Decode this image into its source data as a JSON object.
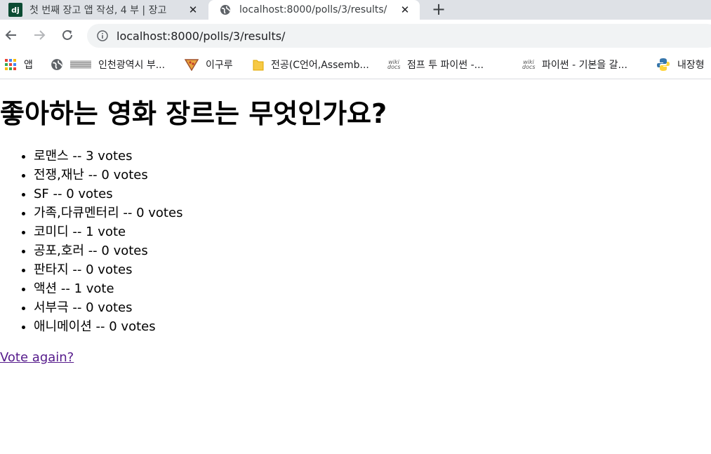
{
  "browser": {
    "tabs": [
      {
        "title": "첫 번째 장고 앱 작성, 4 부 | 장고",
        "favicon": "django-icon",
        "active": false
      },
      {
        "title": "localhost:8000/polls/3/results/",
        "favicon": "globe-icon",
        "active": true
      }
    ],
    "newtab_label": "+",
    "close_label": "✕",
    "url": "localhost:8000/polls/3/results/",
    "bookmarks": [
      {
        "label": "앱",
        "icon": "apps-grid-icon"
      },
      {
        "label": "인천광역시 부...",
        "icon": "globe-icon"
      },
      {
        "label": "이구루",
        "icon": "pizza-icon"
      },
      {
        "label": "전공(C언어,Assemb...",
        "icon": "folder-icon"
      },
      {
        "label": "점프 투 파이썬 -...",
        "icon": "wikidocs-icon"
      },
      {
        "label": "파이썬 - 기본을 갈...",
        "icon": "wikidocs-icon"
      },
      {
        "label": "내장형",
        "icon": "python-icon"
      }
    ]
  },
  "page": {
    "question": "좋아하는 영화 장르는 무엇인가요?",
    "results": [
      {
        "choice": "로맨스",
        "sep": " -- ",
        "votes": "3 votes"
      },
      {
        "choice": "전쟁,재난",
        "sep": " -- ",
        "votes": "0 votes"
      },
      {
        "choice": "SF",
        "sep": " -- ",
        "votes": "0 votes"
      },
      {
        "choice": "가족,다큐멘터리",
        "sep": " -- ",
        "votes": "0 votes"
      },
      {
        "choice": "코미디",
        "sep": " -- ",
        "votes": "1 vote"
      },
      {
        "choice": "공포,호러",
        "sep": " -- ",
        "votes": "0 votes"
      },
      {
        "choice": "판타지",
        "sep": " -- ",
        "votes": "0 votes"
      },
      {
        "choice": "액션",
        "sep": " -- ",
        "votes": "1 vote"
      },
      {
        "choice": "서부극",
        "sep": " -- ",
        "votes": "0 votes"
      },
      {
        "choice": "애니메이션",
        "sep": " -- ",
        "votes": "0 votes"
      }
    ],
    "vote_again_label": "Vote again?"
  },
  "colors": {
    "tabstrip_bg": "#dee1e6",
    "omnibox_bg": "#f1f3f4",
    "django_green": "#0c4b33",
    "visited_link": "#551a8b"
  }
}
